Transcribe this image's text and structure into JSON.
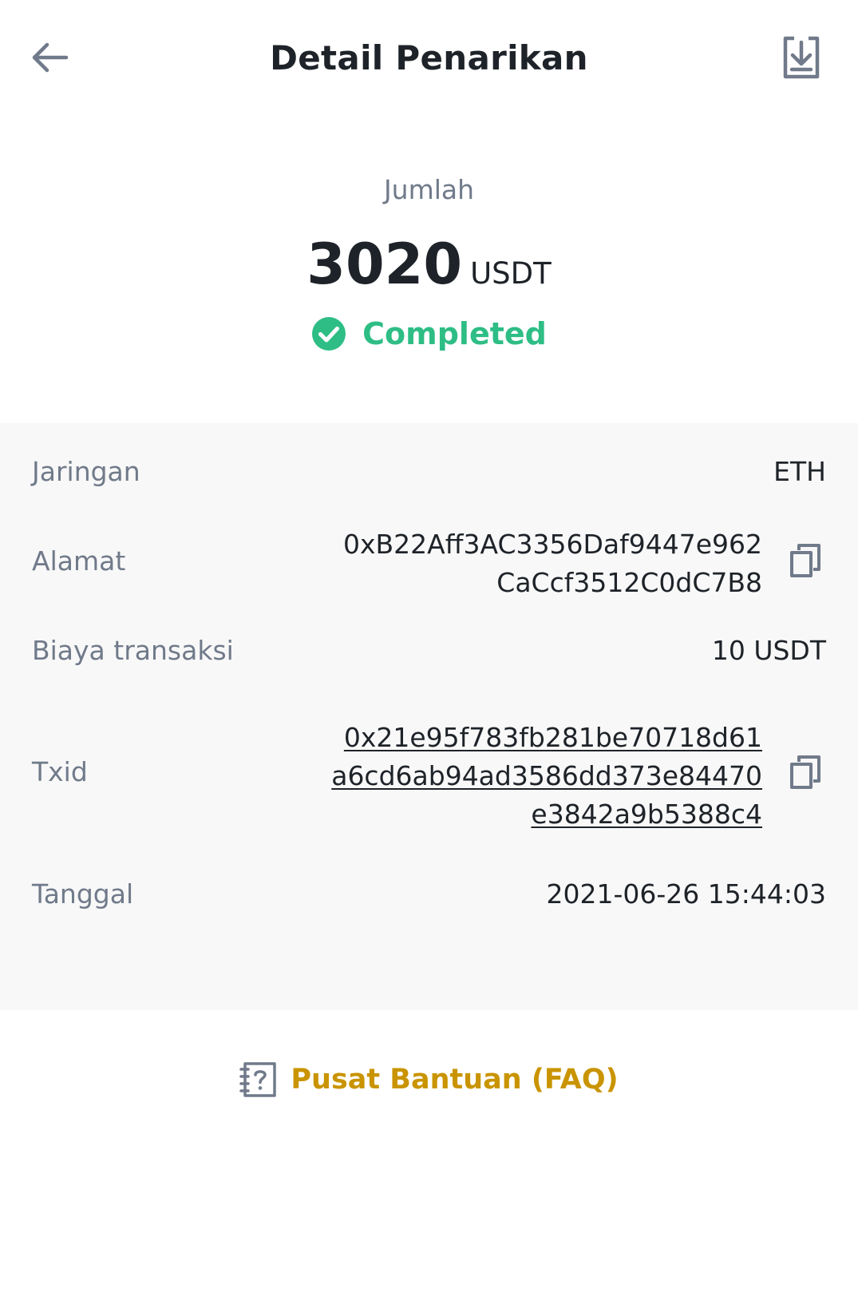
{
  "header": {
    "title": "Detail Penarikan",
    "back_icon": "arrow-left-icon",
    "download_icon": "download-icon"
  },
  "amount": {
    "label": "Jumlah",
    "value": "3020",
    "unit": "USDT"
  },
  "status": {
    "text": "Completed",
    "icon": "check-circle-icon",
    "color": "#2ebd85"
  },
  "details": {
    "network": {
      "label": "Jaringan",
      "value": "ETH"
    },
    "address": {
      "label": "Alamat",
      "lines": [
        "0xB22Aff3AC3356Daf9447e962",
        "CaCcf3512C0dC7B8"
      ],
      "copy_icon": "copy-icon"
    },
    "fee": {
      "label": "Biaya transaksi",
      "value": "10 USDT"
    },
    "txid": {
      "label": "Txid",
      "lines": [
        "0x21e95f783fb281be70718d61",
        "a6cd6ab94ad3586dd373e84470",
        "e3842a9b5388c4"
      ],
      "copy_icon": "copy-icon"
    },
    "date": {
      "label": "Tanggal",
      "value": "2021-06-26 15:44:03"
    }
  },
  "faq": {
    "text": "Pusat Bantuan (FAQ)",
    "icon": "help-center-icon",
    "color": "#c99400"
  }
}
